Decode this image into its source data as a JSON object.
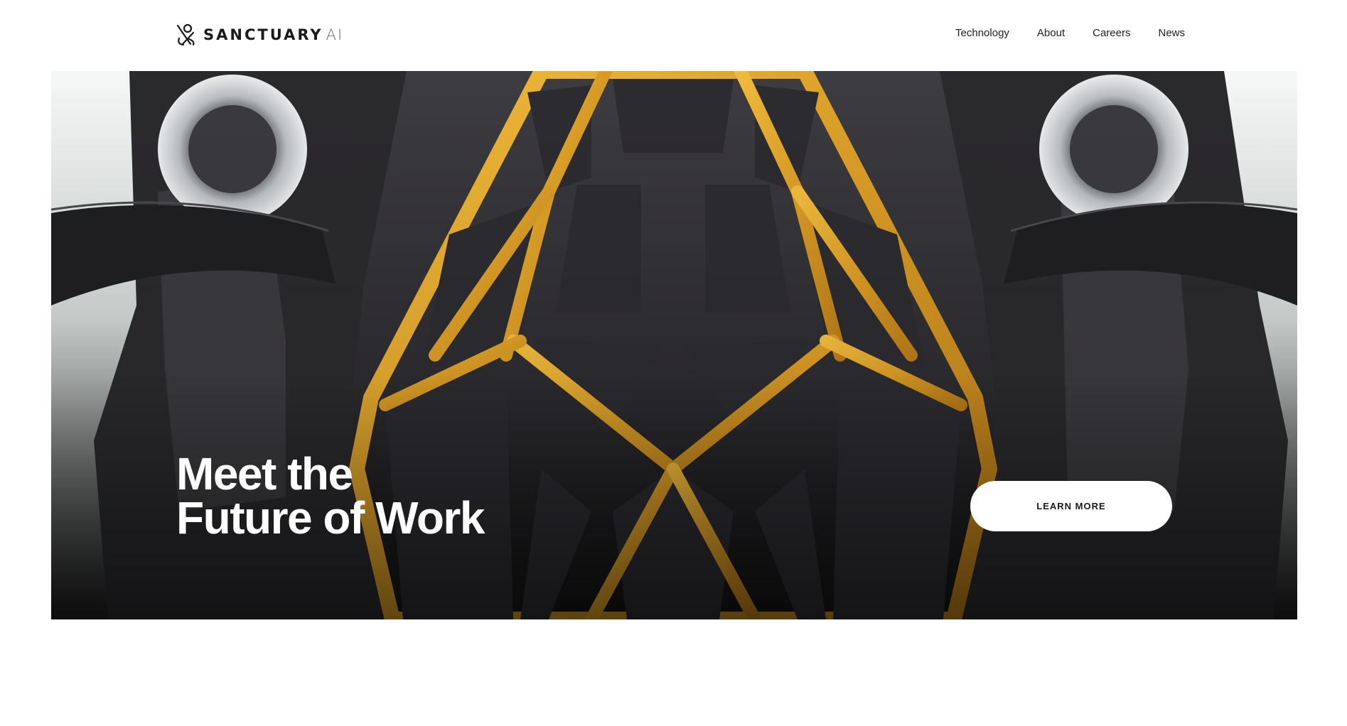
{
  "brand": {
    "name": "SANCTUARY",
    "suffix": "AI"
  },
  "nav": {
    "items": [
      {
        "label": "Technology"
      },
      {
        "label": "About"
      },
      {
        "label": "Careers"
      },
      {
        "label": "News"
      }
    ]
  },
  "hero": {
    "title_line1": "Meet the",
    "title_line2": "Future of Work",
    "cta_label": "LEARN MORE",
    "image_description_icon": "robot-torso-image"
  },
  "colors": {
    "accent_gold": "#e0a82e",
    "background": "#ffffff",
    "text_dark": "#1a1a1a"
  }
}
